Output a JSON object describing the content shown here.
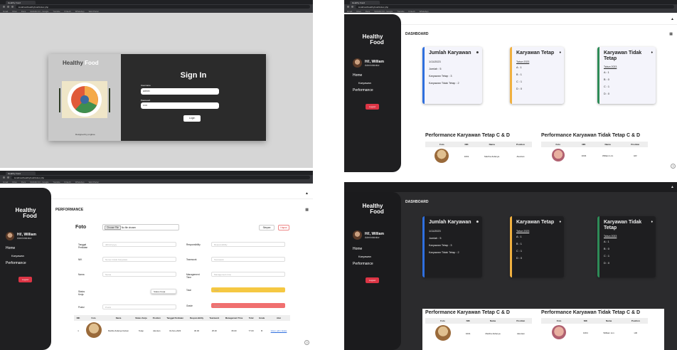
{
  "browser": {
    "tab_title": "Healthy Food",
    "url": "localhost/healthyfood/index.php",
    "bookmarks": [
      "Gmail",
      "Drive",
      "Docs",
      "SIAKAD ICI - Google",
      "Youtube",
      "Fintech",
      "WhatsApp",
      "Web Portal",
      "Tokopedia",
      "Udemy"
    ]
  },
  "login": {
    "brand_healthy": "Healthy",
    "brand_food": "Food",
    "credit": "Designed by pngtree",
    "title": "Sign In",
    "username_label": "Username",
    "username_value": "admin",
    "password_label": "Password",
    "password_value": "•••••",
    "button": "Login"
  },
  "sidebar": {
    "logo_top": "Healthy",
    "logo_bottom": "Food",
    "greeting": "Hi!, William",
    "role": "Administrator",
    "menu": {
      "home": "Home",
      "karyawan": "Karyawan",
      "performance": "Performance"
    },
    "logout": "Logout"
  },
  "dashboard": {
    "heading": "DASHBOARD",
    "cards": [
      {
        "title": "Jumlah Karyawan",
        "date": "1/11/2023",
        "lines": [
          "Jumlah : 5",
          "Karyawan Tetap : 3",
          "Karyawan Tidak Tetap : 2"
        ],
        "color": "#2f6fde"
      },
      {
        "title": "Karyawan Tetap",
        "date": "Tahun 2023",
        "lines": [
          "A : 1",
          "B : 1",
          "C : 1",
          "D : 0"
        ],
        "color": "#f0b040"
      },
      {
        "title": "Karyawan Tidak Tetap",
        "date": "Tahun 2023",
        "lines": [
          "A : 1",
          "B : 0",
          "C : 1",
          "D : 0"
        ],
        "color": "#2e8b57"
      }
    ],
    "perf_tetap_title": "Performance Karyawan Tetap C & D",
    "perf_tidak_title": "Performance Karyawan Tidak Tetap C & D",
    "table_headers": [
      "Foto",
      "NIK",
      "Nama",
      "Position"
    ],
    "tetap_row": {
      "nik": "1001",
      "nama": "Martha Zefanya",
      "position": "Akuntan"
    },
    "tidak_row": {
      "nik": "1004",
      "nama": "William Lim",
      "position": "HR"
    }
  },
  "performance": {
    "heading": "PERFORMANCE",
    "foto_label": "Foto",
    "file_button": "Choose File",
    "file_text": "No file chosen",
    "simpan": "Simpan",
    "hapus": "Hapus",
    "fields": {
      "tanggal": {
        "label": "Tanggal Penilaian",
        "placeholder": "dd/mm/yyyy"
      },
      "nik": {
        "label": "NIK",
        "placeholder": "Nomor Induk Karyawan"
      },
      "nama": {
        "label": "Nama",
        "placeholder": "Nama"
      },
      "status": {
        "label": "Status Kerja",
        "placeholder": "Status Kerja"
      },
      "posisi": {
        "label": "Posisi",
        "placeholder": "Posisi"
      },
      "responsibility": {
        "label": "Responsibility",
        "placeholder": "Responsibility"
      },
      "teamwork": {
        "label": "Teamwork",
        "placeholder": "Teamwork"
      },
      "management": {
        "label": "Management Time",
        "placeholder": "Management time"
      },
      "total": {
        "label": "Total",
        "placeholder": "Total"
      },
      "grade": {
        "label": "Grade",
        "placeholder": "Grade"
      }
    },
    "table_headers": [
      "NIK",
      "Foto",
      "Nama",
      "Status Kerja",
      "Position",
      "Tanggal Penilaian",
      "Responsibility",
      "Teamwork",
      "Management Time",
      "Total",
      "Grade",
      "Aksi"
    ],
    "row": {
      "nik": "1",
      "nama": "Martha Zefanya Nelson",
      "status": "Tetap",
      "position": "Akuntan",
      "tanggal": "01-Nov-2023",
      "responsibility": "30.00",
      "teamwork": "25.00",
      "management": "83.00",
      "total": "77.00",
      "grade": "B",
      "aksi": "View | edit | delete"
    }
  },
  "colors": {
    "total_field": "#f5c842",
    "grade_field": "#f07070"
  }
}
